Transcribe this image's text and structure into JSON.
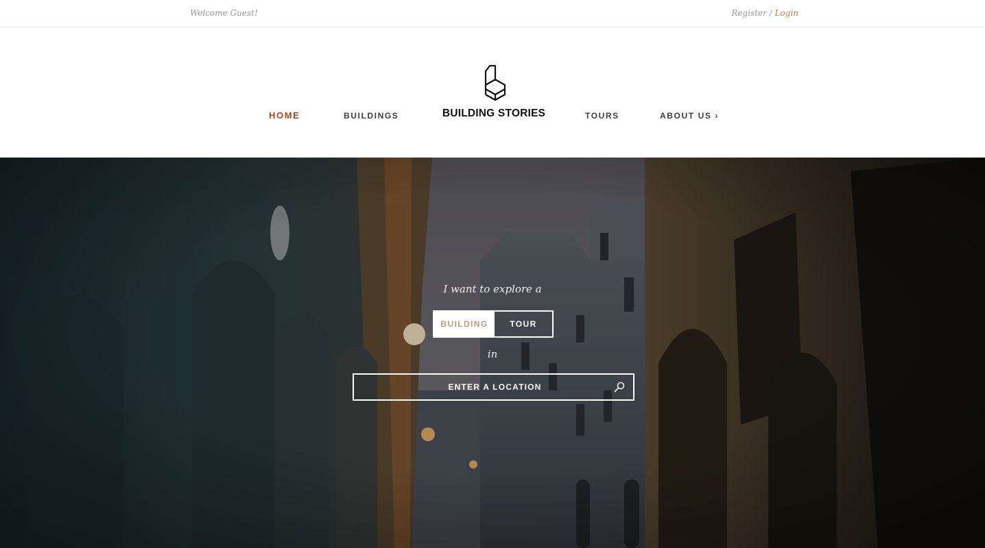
{
  "topbar": {
    "welcome": "Welcome Guest!",
    "register": "Register",
    "separator": " / ",
    "login": "Login"
  },
  "nav": {
    "home": "HOME",
    "buildings": "BUILDINGS",
    "brand": "BUILDING STORIES",
    "tours": "TOURS",
    "about": "ABOUT US ›"
  },
  "hero": {
    "explore_text": "I want to explore a",
    "option_building": "BUILDING",
    "option_tour": "TOUR",
    "in_text": "in",
    "location_placeholder": "ENTER A LOCATION"
  },
  "colors": {
    "accent": "#b8401c",
    "login": "#c47b3b",
    "building_option_text": "#c09a86"
  },
  "icons": {
    "logo": "building-book-icon",
    "search": "search-icon"
  }
}
